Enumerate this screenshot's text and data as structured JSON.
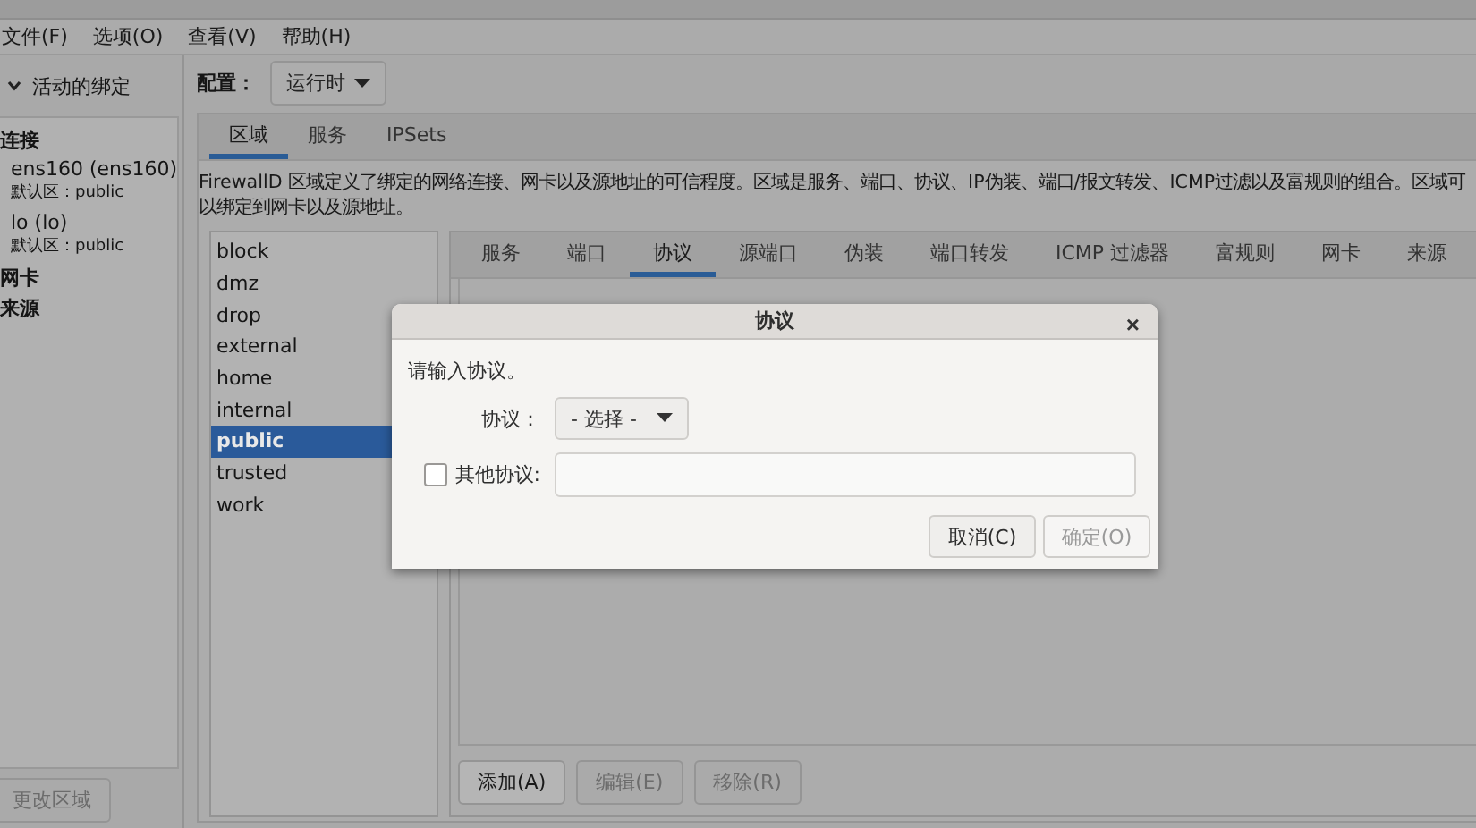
{
  "menu": [
    {
      "label": "文件(F)"
    },
    {
      "label": "选项(O)"
    },
    {
      "label": "查看(V)"
    },
    {
      "label": "帮助(H)"
    }
  ],
  "bindings": {
    "title": "活动的绑定",
    "expanded": true,
    "groups": [
      {
        "label": "连接",
        "children": [
          {
            "name": "ens160 (ens160)",
            "detail": "默认区：public"
          },
          {
            "name": "lo (lo)",
            "detail": "默认区：public"
          }
        ]
      },
      {
        "label": "网卡"
      },
      {
        "label": "来源"
      }
    ],
    "button": {
      "label": "更改区域",
      "disabled": true
    }
  },
  "config": {
    "label": "配置：",
    "value": "运行时"
  },
  "tabs": [
    {
      "label": "区域",
      "selected": true
    },
    {
      "label": "服务",
      "selected": false
    },
    {
      "label": "IPSets",
      "selected": false
    }
  ],
  "description": "FirewallD 区域定义了绑定的网络连接、网卡以及源地址的可信程度。区域是服务、端口、协议、IP伪装、端口/报文转发、ICMP过滤以及富规则的组合。区域可以绑定到网卡以及源地址。",
  "zones": [
    {
      "name": "block",
      "selected": false
    },
    {
      "name": "dmz",
      "selected": false
    },
    {
      "name": "drop",
      "selected": false
    },
    {
      "name": "external",
      "selected": false
    },
    {
      "name": "home",
      "selected": false
    },
    {
      "name": "internal",
      "selected": false
    },
    {
      "name": "public",
      "selected": true
    },
    {
      "name": "trusted",
      "selected": false
    },
    {
      "name": "work",
      "selected": false
    }
  ],
  "zone_tabs": [
    {
      "label": "服务",
      "selected": false
    },
    {
      "label": "端口",
      "selected": false
    },
    {
      "label": "协议",
      "selected": true
    },
    {
      "label": "源端口",
      "selected": false
    },
    {
      "label": "伪装",
      "selected": false
    },
    {
      "label": "端口转发",
      "selected": false
    },
    {
      "label": "ICMP 过滤器",
      "selected": false
    },
    {
      "label": "富规则",
      "selected": false
    },
    {
      "label": "网卡",
      "selected": false
    },
    {
      "label": "来源",
      "selected": false
    }
  ],
  "actions": [
    {
      "label": "添加(A)",
      "disabled": false
    },
    {
      "label": "编辑(E)",
      "disabled": true
    },
    {
      "label": "移除(R)",
      "disabled": true
    }
  ],
  "dialog": {
    "title": "协议",
    "close": "×",
    "prompt": "请输入协议。",
    "protocol_label": "协议：",
    "protocol_value": "- 选择 -",
    "other": {
      "label": "其他协议:",
      "checked": false
    },
    "buttons": [
      {
        "label": "取消(C)",
        "disabled": false
      },
      {
        "label": "确定(O)",
        "disabled": true
      }
    ]
  }
}
